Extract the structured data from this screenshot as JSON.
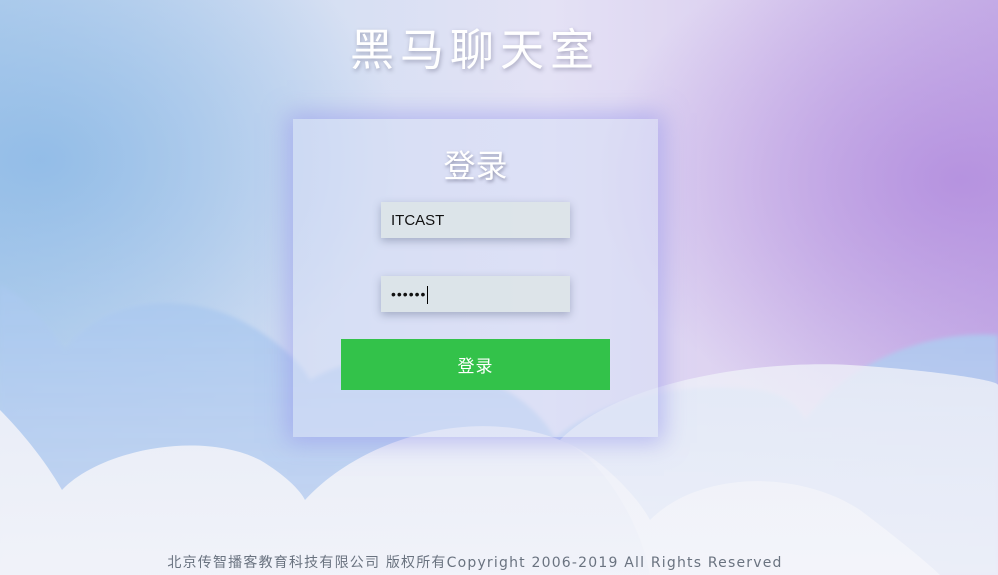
{
  "app": {
    "title": "黑马聊天室"
  },
  "login": {
    "heading": "登录",
    "username_value": "ITCAST",
    "password_masked": "••••••",
    "submit_label": "登录"
  },
  "footer": {
    "text": "北京传智播客教育科技有限公司 版权所有Copyright 2006-2019 All Rights Reserved"
  },
  "colors": {
    "button": "#33c24a",
    "title_text": "#ffffff",
    "footer_text": "#6a7380"
  }
}
